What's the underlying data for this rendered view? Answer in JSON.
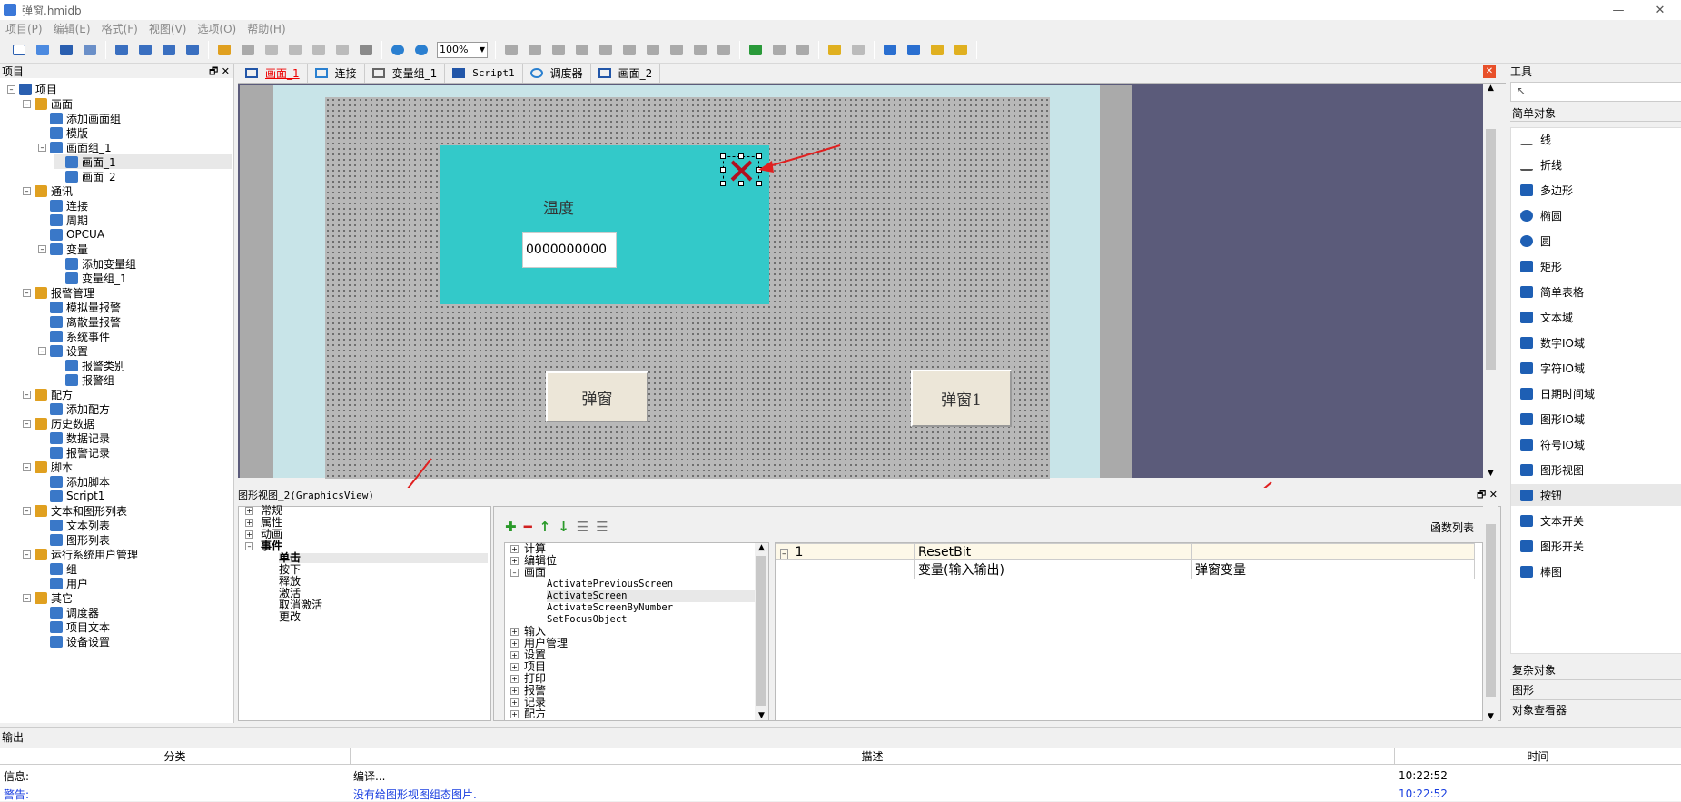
{
  "window": {
    "title": "弹窗.hmidb",
    "minimize": "—",
    "close": "✕"
  },
  "menu": [
    "项目(P)",
    "编辑(E)",
    "格式(F)",
    "视图(V)",
    "选项(O)",
    "帮助(H)"
  ],
  "toolbar": {
    "zoom": "100%"
  },
  "project_panel": {
    "title": "项目",
    "pin": "🗗",
    "close": "✕",
    "tree": [
      {
        "label": "项目",
        "level": 0,
        "icon": "project-icon"
      },
      {
        "label": "画面",
        "level": 1,
        "icon": "screen-icon"
      },
      {
        "label": "添加画面组",
        "level": 2,
        "icon": "add-icon"
      },
      {
        "label": "模版",
        "level": 2,
        "icon": "template-icon"
      },
      {
        "label": "画面组_1",
        "level": 2,
        "icon": "screen-group-icon"
      },
      {
        "label": "画面_1",
        "level": 3,
        "icon": "screen-icon"
      },
      {
        "label": "画面_2",
        "level": 3,
        "icon": "screen-icon"
      },
      {
        "label": "通讯",
        "level": 1,
        "icon": "comm-icon"
      },
      {
        "label": "连接",
        "level": 2,
        "icon": "connection-icon"
      },
      {
        "label": "周期",
        "level": 2,
        "icon": "cycle-icon"
      },
      {
        "label": "OPCUA",
        "level": 2,
        "icon": "opcua-icon"
      },
      {
        "label": "变量",
        "level": 2,
        "icon": "variable-icon"
      },
      {
        "label": "添加变量组",
        "level": 3,
        "icon": "add-icon"
      },
      {
        "label": "变量组_1",
        "level": 3,
        "icon": "variable-group-icon"
      },
      {
        "label": "报警管理",
        "level": 1,
        "icon": "alarm-icon"
      },
      {
        "label": "模拟量报警",
        "level": 2,
        "icon": "analog-alarm-icon"
      },
      {
        "label": "离散量报警",
        "level": 2,
        "icon": "discrete-alarm-icon"
      },
      {
        "label": "系统事件",
        "level": 2,
        "icon": "system-event-icon"
      },
      {
        "label": "设置",
        "level": 2,
        "icon": "settings-icon"
      },
      {
        "label": "报警类别",
        "level": 3,
        "icon": "alarm-class-icon"
      },
      {
        "label": "报警组",
        "level": 3,
        "icon": "alarm-group-icon"
      },
      {
        "label": "配方",
        "level": 1,
        "icon": "recipe-icon"
      },
      {
        "label": "添加配方",
        "level": 2,
        "icon": "add-icon"
      },
      {
        "label": "历史数据",
        "level": 1,
        "icon": "history-icon"
      },
      {
        "label": "数据记录",
        "level": 2,
        "icon": "data-log-icon"
      },
      {
        "label": "报警记录",
        "level": 2,
        "icon": "alarm-log-icon"
      },
      {
        "label": "脚本",
        "level": 1,
        "icon": "script-icon"
      },
      {
        "label": "添加脚本",
        "level": 2,
        "icon": "add-icon"
      },
      {
        "label": "Script1",
        "level": 2,
        "icon": "script-icon"
      },
      {
        "label": "文本和图形列表",
        "level": 1,
        "icon": "list-icon"
      },
      {
        "label": "文本列表",
        "level": 2,
        "icon": "text-list-icon"
      },
      {
        "label": "图形列表",
        "level": 2,
        "icon": "graphic-list-icon"
      },
      {
        "label": "运行系统用户管理",
        "level": 1,
        "icon": "user-management-icon"
      },
      {
        "label": "组",
        "level": 2,
        "icon": "group-icon"
      },
      {
        "label": "用户",
        "level": 2,
        "icon": "user-icon"
      },
      {
        "label": "其它",
        "level": 1,
        "icon": "other-icon"
      },
      {
        "label": "调度器",
        "level": 2,
        "icon": "scheduler-icon"
      },
      {
        "label": "项目文本",
        "level": 2,
        "icon": "project-text-icon"
      },
      {
        "label": "设备设置",
        "level": 2,
        "icon": "device-settings-icon"
      }
    ]
  },
  "tabs": [
    {
      "label": "画面_1",
      "active": true
    },
    {
      "label": "连接"
    },
    {
      "label": "变量组_1"
    },
    {
      "label": "Script1"
    },
    {
      "label": "调度器"
    },
    {
      "label": "画面_2"
    }
  ],
  "canvas": {
    "popup_label": "温度",
    "io_value": "0000000000",
    "button1": "弹窗",
    "button2": "弹窗1"
  },
  "graphics_view": {
    "title": "图形视图_2(GraphicsView)",
    "pin": "🗗",
    "close": "✕",
    "categories": [
      "常规",
      "属性",
      "动画",
      "事件"
    ],
    "events": [
      "单击",
      "按下",
      "释放",
      "激活",
      "取消激活",
      "更改"
    ],
    "function_list_label": "函数列表",
    "func_tree": {
      "top": [
        "计算",
        "编辑位"
      ],
      "screen": "画面",
      "screen_items": [
        "ActivatePreviousScreen",
        "ActivateScreen",
        "ActivateScreenByNumber",
        "SetFocusObject"
      ],
      "bottom": [
        "输入",
        "用户管理",
        "设置",
        "项目",
        "打印",
        "报警",
        "记录",
        "配方"
      ]
    },
    "table": {
      "row_num": "1",
      "func": "ResetBit",
      "param_name": "变量(输入输出)",
      "param_value": "弹窗变量"
    }
  },
  "tools_panel": {
    "title": "工具",
    "section": "简单对象",
    "items": [
      {
        "label": "线",
        "icon": "line-icon",
        "color": "#555"
      },
      {
        "label": "折线",
        "icon": "polyline-icon",
        "color": "#555"
      },
      {
        "label": "多边形",
        "icon": "polygon-icon",
        "color": "#1e5fb4"
      },
      {
        "label": "椭圆",
        "icon": "ellipse-icon",
        "color": "#1e5fb4"
      },
      {
        "label": "圆",
        "icon": "circle-icon",
        "color": "#1e5fb4"
      },
      {
        "label": "矩形",
        "icon": "rectangle-icon",
        "color": "#1e5fb4"
      },
      {
        "label": "简单表格",
        "icon": "table-icon",
        "color": "#1e5fb4"
      },
      {
        "label": "文本域",
        "icon": "text-field-icon",
        "color": "#1e5fb4"
      },
      {
        "label": "数字IO域",
        "icon": "numeric-io-icon",
        "color": "#1e5fb4"
      },
      {
        "label": "字符IO域",
        "icon": "char-io-icon",
        "color": "#1e5fb4"
      },
      {
        "label": "日期时间域",
        "icon": "datetime-icon",
        "color": "#1e5fb4"
      },
      {
        "label": "图形IO域",
        "icon": "graphic-io-icon",
        "color": "#1e5fb4"
      },
      {
        "label": "符号IO域",
        "icon": "symbol-io-icon",
        "color": "#1e5fb4"
      },
      {
        "label": "图形视图",
        "icon": "graphic-view-icon",
        "color": "#1e5fb4"
      },
      {
        "label": "按钮",
        "icon": "button-icon",
        "color": "#1e5fb4"
      },
      {
        "label": "文本开关",
        "icon": "text-switch-icon",
        "color": "#1e5fb4"
      },
      {
        "label": "图形开关",
        "icon": "graphic-switch-icon",
        "color": "#1e5fb4"
      },
      {
        "label": "棒图",
        "icon": "bar-graph-icon",
        "color": "#1e5fb4"
      }
    ],
    "bottom_sections": [
      "复杂对象",
      "图形",
      "对象查看器"
    ]
  },
  "output": {
    "title": "输出",
    "headers": [
      "分类",
      "描述",
      "时间"
    ],
    "rows": [
      {
        "type": "信息:",
        "desc": "编译...",
        "time": "10:22:52",
        "color": "#000"
      },
      {
        "type": "警告:",
        "desc": "没有给图形视图组态图片.",
        "time": "10:22:52",
        "color": "#1a3fe0"
      }
    ]
  }
}
